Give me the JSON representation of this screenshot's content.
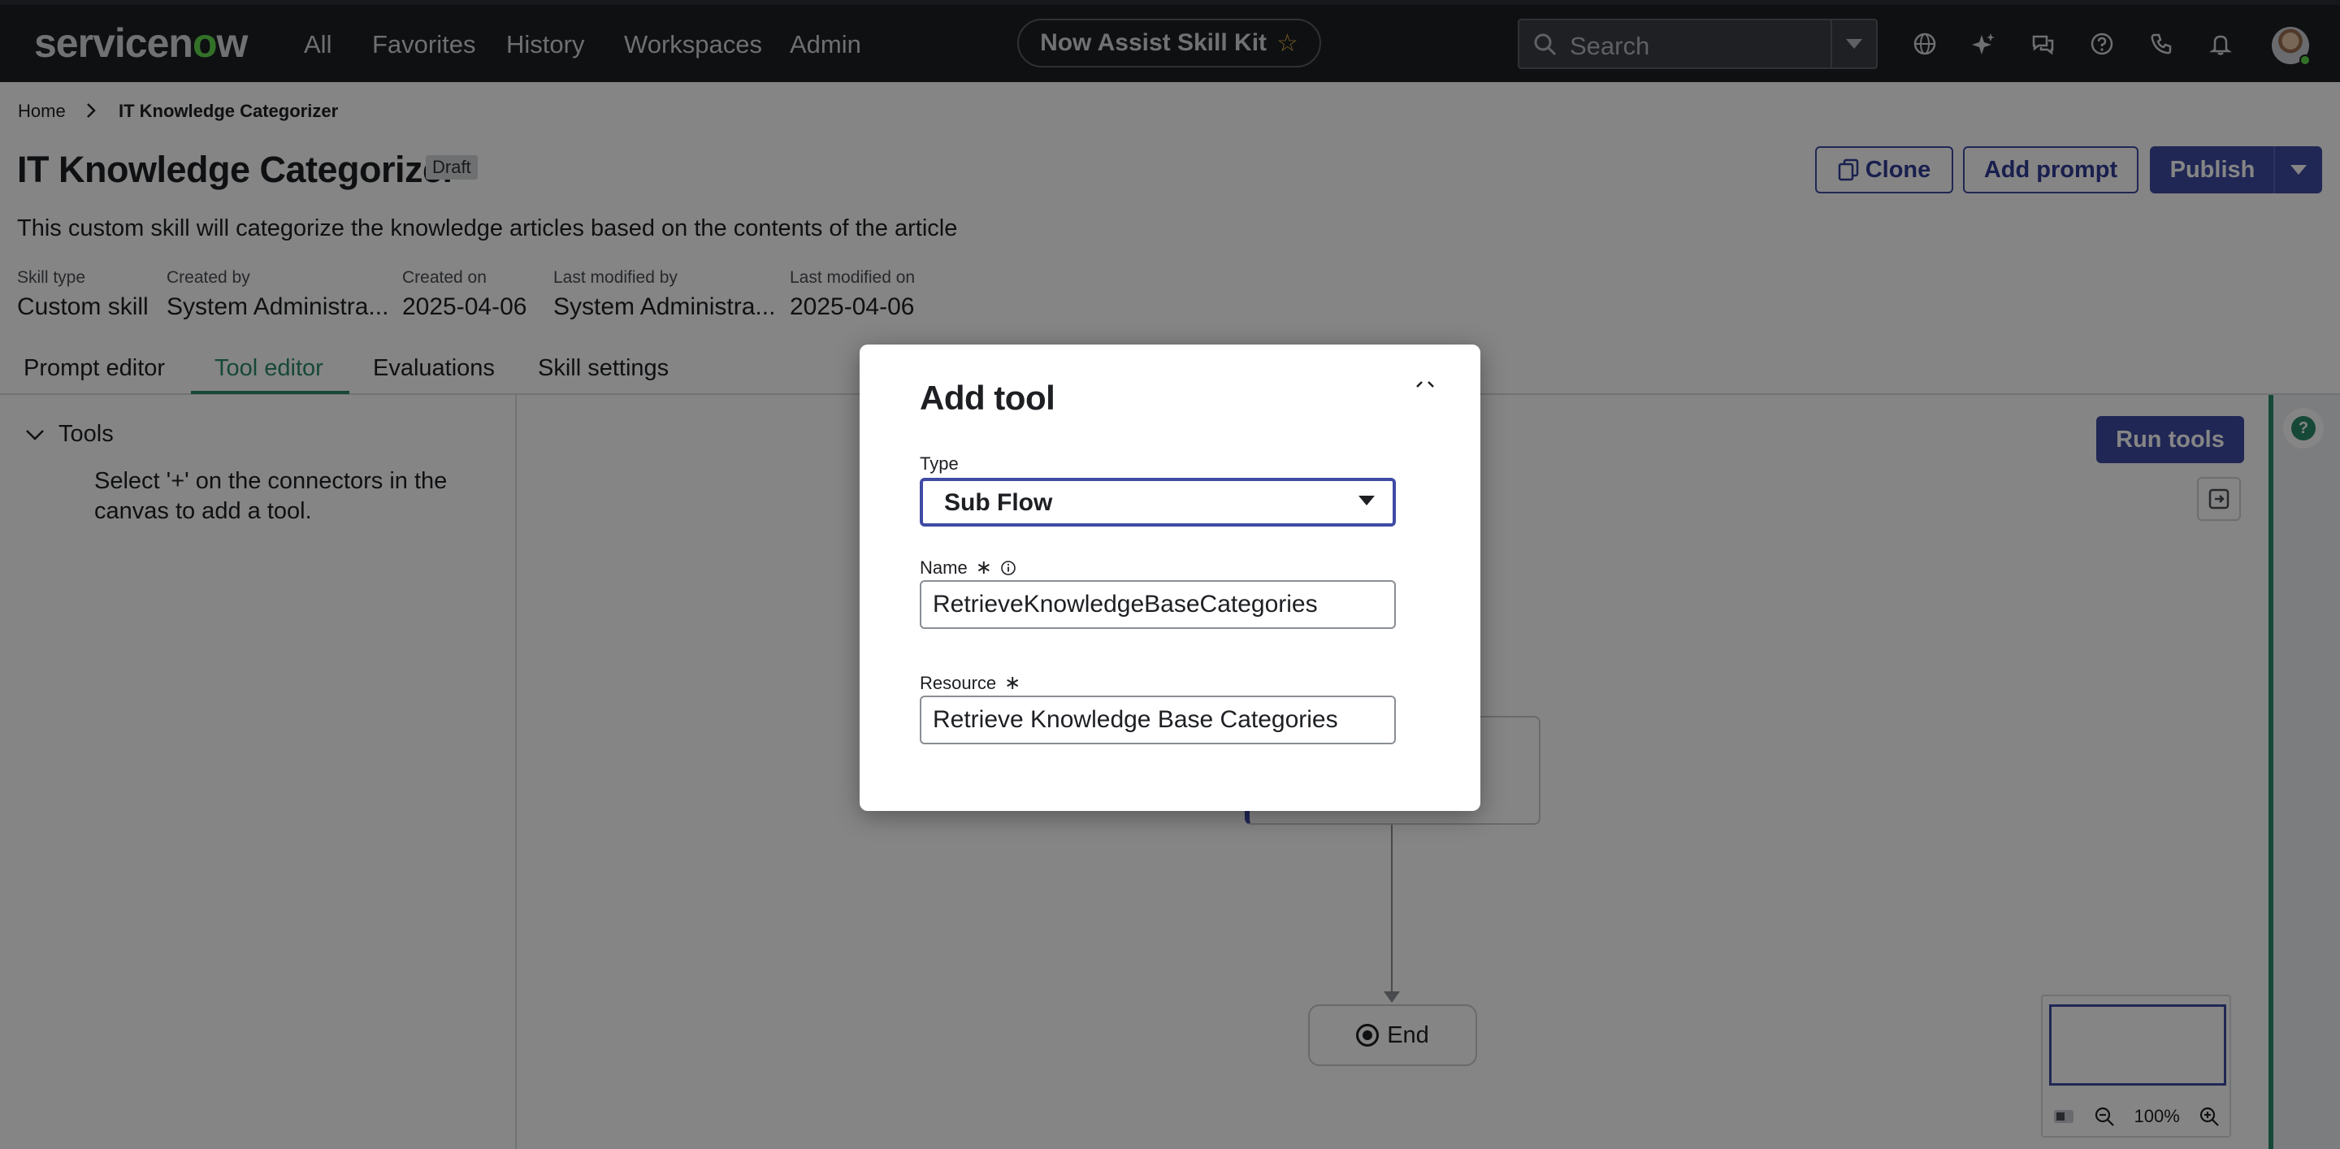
{
  "topnav": {
    "logo_text": "servicenow",
    "items": [
      "All",
      "Favorites",
      "History",
      "Workspaces",
      "Admin"
    ],
    "app_pill": "Now Assist Skill Kit",
    "search_placeholder": "Search",
    "icons": [
      "globe-icon",
      "sparkle-icon",
      "chat-icon",
      "help-icon",
      "phone-icon",
      "bell-icon"
    ]
  },
  "breadcrumb": {
    "home": "Home",
    "current": "IT Knowledge Categorizer"
  },
  "page": {
    "title": "IT Knowledge Categorizer",
    "status_badge": "Draft",
    "description": "This custom skill will categorize the knowledge articles based on the contents of the article",
    "meta": [
      {
        "label": "Skill type",
        "value": "Custom skill"
      },
      {
        "label": "Created by",
        "value": "System Administra..."
      },
      {
        "label": "Created on",
        "value": "2025-04-06"
      },
      {
        "label": "Last modified by",
        "value": "System Administra..."
      },
      {
        "label": "Last modified on",
        "value": "2025-04-06"
      }
    ],
    "buttons": {
      "clone": "Clone",
      "add_prompt": "Add prompt",
      "publish": "Publish"
    }
  },
  "tabs": [
    "Prompt editor",
    "Tool editor",
    "Evaluations",
    "Skill settings"
  ],
  "active_tab": "Tool editor",
  "tools_panel": {
    "heading": "Tools",
    "help_text": "Select '+' on the connectors in the canvas to add a tool."
  },
  "canvas": {
    "run_tools": "Run tools",
    "end_node": "End",
    "zoom": "100%"
  },
  "modal": {
    "title": "Add tool",
    "type_label": "Type",
    "type_value": "Sub Flow",
    "name_label": "Name",
    "name_value": "RetrieveKnowledgeBaseCategories",
    "resource_label": "Resource",
    "resource_value": "Retrieve Knowledge Base Categories",
    "required_mark": "∗"
  },
  "colors": {
    "topbar_bg": "#1b1f24",
    "brand_green": "#62d84e",
    "primary": "#3f4ba4",
    "active_tab": "#2b8a6b"
  }
}
